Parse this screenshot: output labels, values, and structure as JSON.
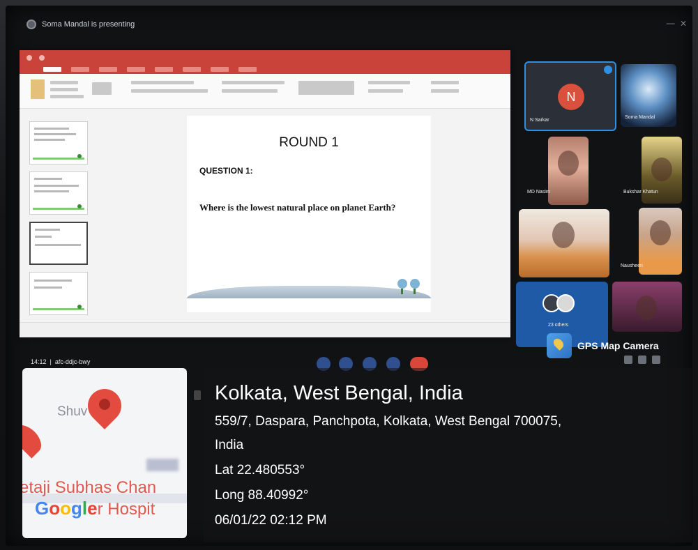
{
  "meeting": {
    "presenter_banner": "Soma Mandal is presenting",
    "clock": "14:12",
    "meeting_code": "afc-ddjc-bwy"
  },
  "slide": {
    "heading": "ROUND 1",
    "question_label": "QUESTION 1:",
    "question_text": "Where is the lowest natural place on planet Earth?"
  },
  "participants": [
    {
      "name": "N Sarkar",
      "initial": "N",
      "pinned": true
    },
    {
      "name": "Soma Mandal"
    },
    {
      "name": "MD Nasim"
    },
    {
      "name": "Bukshar Khatun"
    },
    {
      "name": "Nausheen"
    },
    {
      "name": "23 others"
    }
  ],
  "gps": {
    "app_name": "GPS Map Camera",
    "city": "Kolkata, West Bengal, India",
    "address_line1": "559/7, Daspara, Panchpota, Kolkata, West Bengal 700075,",
    "address_line2": "India",
    "lat": "Lat 22.480553°",
    "long": "Long 88.40992°",
    "datetime": "06/01/22 02:12 PM"
  },
  "map": {
    "place_label": "Shuv       d",
    "hospital_label": "etaji Subhas Chan",
    "hospital_suffix": "r Hospit",
    "logo_letters": [
      "G",
      "o",
      "o",
      "g",
      "l",
      "e"
    ],
    "logo_colors": [
      "#4285F4",
      "#EA4335",
      "#FBBC05",
      "#4285F4",
      "#34A853",
      "#EA4335"
    ]
  },
  "colors": {
    "ppt_titlebar": "#c9433a",
    "pin_highlight": "#2f8fe0",
    "avatar": "#d9503d",
    "others_tile": "#1e5aa6",
    "end_call": "#d9473a"
  }
}
